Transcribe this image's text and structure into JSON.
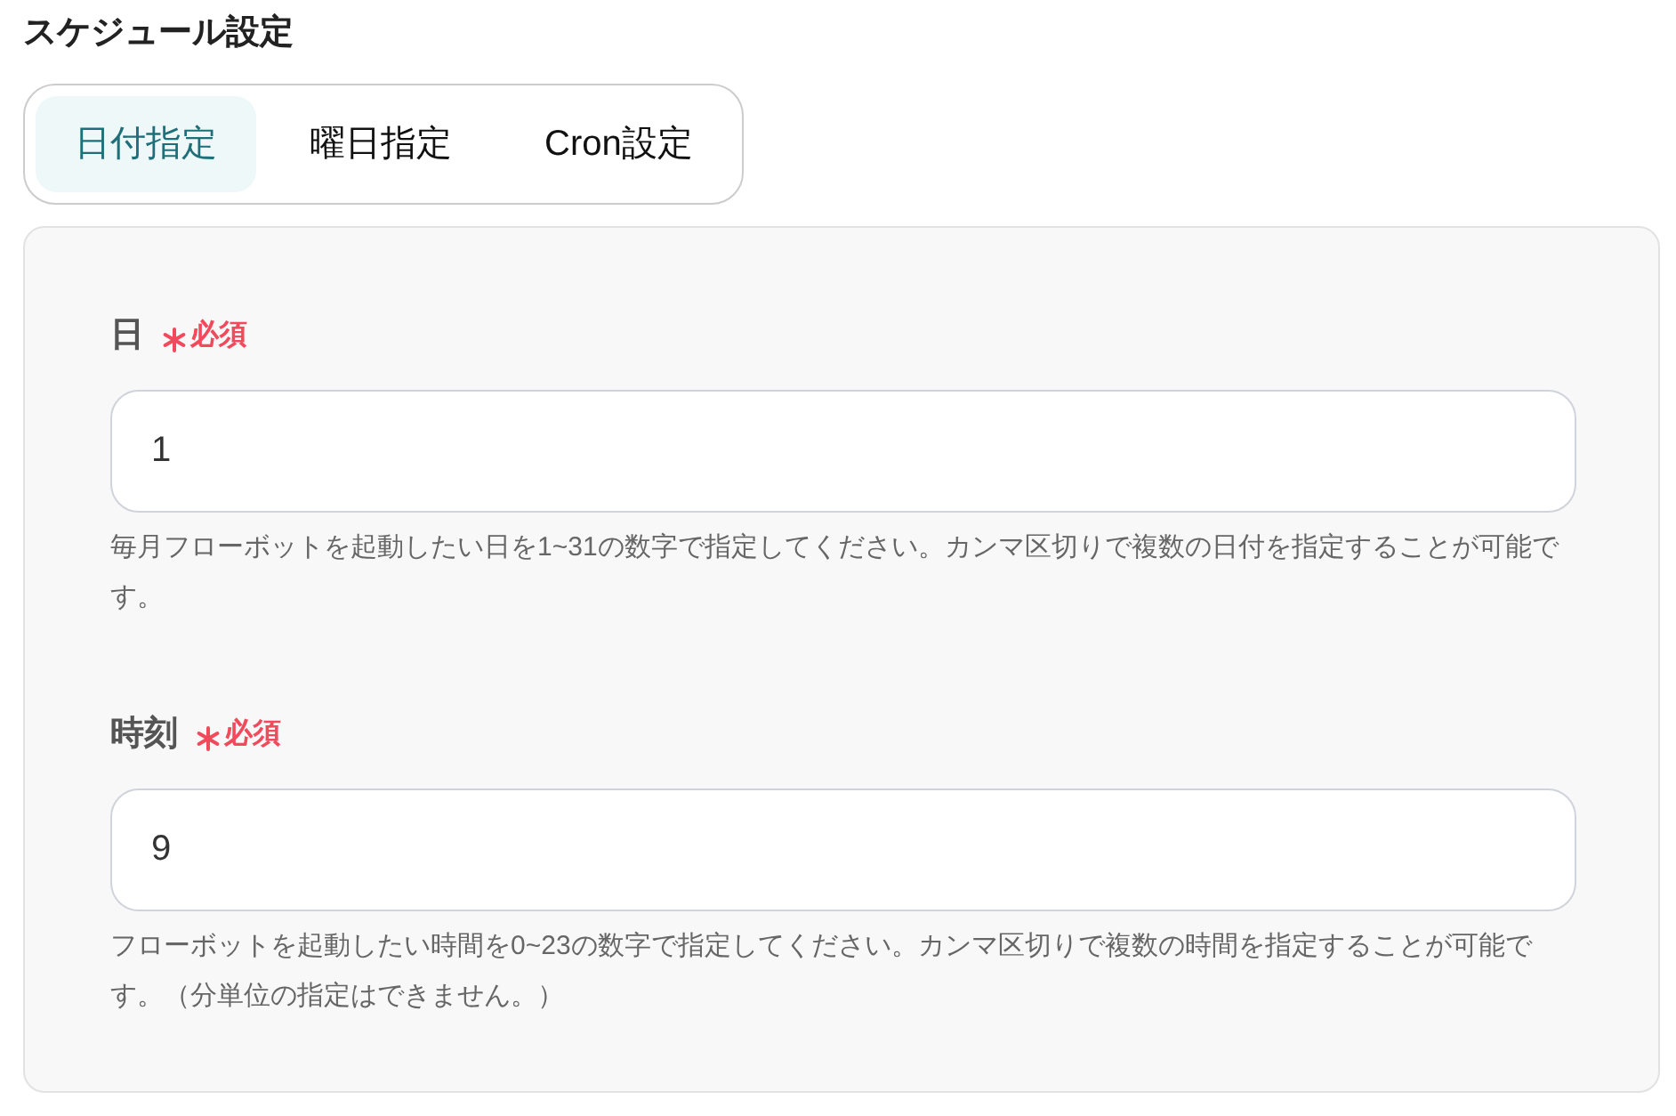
{
  "heading": "スケジュール設定",
  "tabs": [
    {
      "label": "日付指定",
      "selected": true
    },
    {
      "label": "曜日指定",
      "selected": false
    },
    {
      "label": "Cron設定",
      "selected": false
    }
  ],
  "fields": [
    {
      "label": "日",
      "required": true,
      "required_text": "必須",
      "value": "1",
      "help": "毎月フローボットを起動したい日を1~31の数字で指定してください。カンマ区切りで複数の日付を指定することが可能です。"
    },
    {
      "label": "時刻",
      "required": true,
      "required_text": "必須",
      "value": "9",
      "help": "フローボットを起動したい時間を0~23の数字で指定してください。カンマ区切りで複数の時間を指定することが可能です。（分単位の指定はできません。）"
    }
  ]
}
